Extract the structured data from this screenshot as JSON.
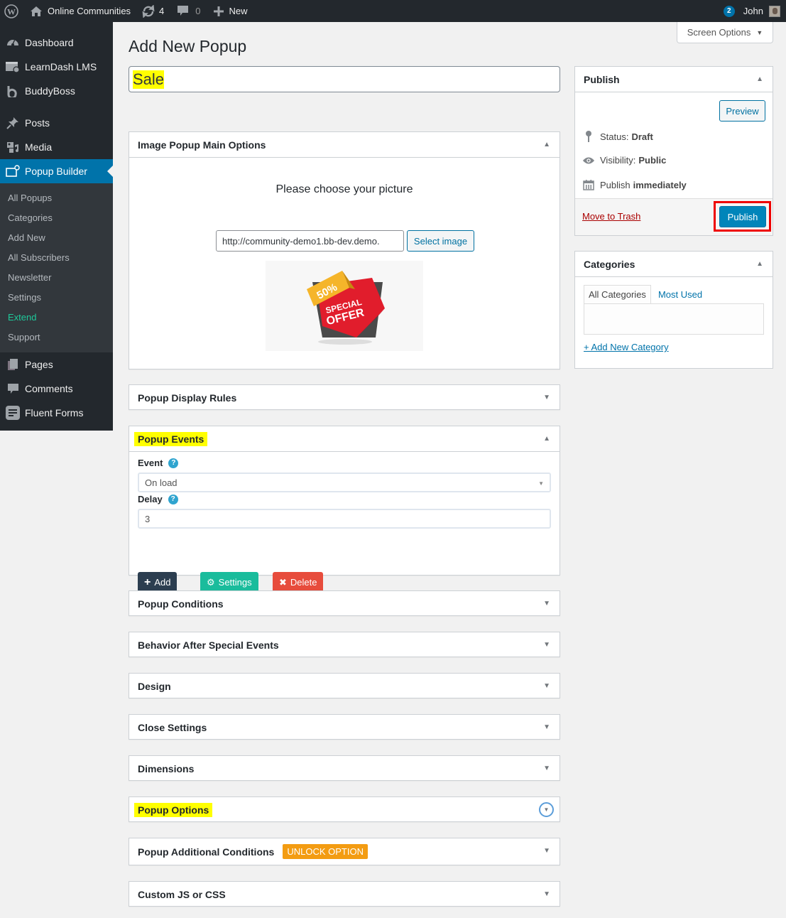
{
  "adminbar": {
    "site_name": "Online Communities",
    "updates_count": "4",
    "comments_count": "0",
    "new_label": "New",
    "notifications_count": "2",
    "user_name": "John"
  },
  "sidebar": {
    "top_items": [
      {
        "label": "Dashboard",
        "icon": "dashboard-icon"
      },
      {
        "label": "LearnDash LMS",
        "icon": "learndash-icon"
      },
      {
        "label": "BuddyBoss",
        "icon": "buddyboss-icon"
      }
    ],
    "mid_items": [
      {
        "label": "Posts",
        "icon": "pin-icon"
      },
      {
        "label": "Media",
        "icon": "media-icon"
      },
      {
        "label": "Popup Builder",
        "icon": "popup-builder-icon"
      }
    ],
    "submenu": [
      {
        "label": "All Popups"
      },
      {
        "label": "Categories"
      },
      {
        "label": "Add New"
      },
      {
        "label": "All Subscribers"
      },
      {
        "label": "Newsletter"
      },
      {
        "label": "Settings"
      },
      {
        "label": "Extend"
      },
      {
        "label": "Support"
      }
    ],
    "bottom_items": [
      {
        "label": "Pages",
        "icon": "pages-icon"
      },
      {
        "label": "Comments",
        "icon": "comments-icon"
      },
      {
        "label": "Fluent Forms",
        "icon": "fluent-forms-icon"
      }
    ],
    "accent_color": "#0073aa",
    "extend_color": "#1ec99a"
  },
  "screen_options_label": "Screen Options",
  "page_title": "Add New Popup",
  "title_value": "Sale",
  "image_options": {
    "title": "Image Popup Main Options",
    "prompt": "Please choose your picture",
    "url_value": "http://community-demo1.bb-dev.demo.",
    "select_label": "Select image",
    "image_text_top": "50%",
    "image_text_line1": "SPECIAL",
    "image_text_line2": "OFFER"
  },
  "display_rules_title": "Popup Display Rules",
  "events": {
    "title": "Popup Events",
    "event_label": "Event",
    "event_value": "On load",
    "delay_label": "Delay",
    "delay_value": "3",
    "add_label": "Add",
    "settings_label": "Settings",
    "delete_label": "Delete",
    "add_color": "#2c3e50",
    "settings_color": "#1abc9c",
    "delete_color": "#e74c3c"
  },
  "collapsed_boxes": [
    {
      "title": "Popup Conditions"
    },
    {
      "title": "Behavior After Special Events"
    },
    {
      "title": "Design"
    },
    {
      "title": "Close Settings"
    },
    {
      "title": "Dimensions"
    },
    {
      "title": "Popup Options"
    },
    {
      "title": "Popup Additional Conditions",
      "badge": "UNLOCK OPTION"
    },
    {
      "title": "Custom JS or CSS"
    }
  ],
  "publish": {
    "title": "Publish",
    "preview_label": "Preview",
    "status_label": "Status:",
    "status_value": "Draft",
    "visibility_label": "Visibility:",
    "visibility_value": "Public",
    "schedule_label": "Publish",
    "schedule_value": "immediately",
    "trash_label": "Move to Trash",
    "publish_label": "Publish"
  },
  "categories": {
    "title": "Categories",
    "tab_all": "All Categories",
    "tab_most_used": "Most Used",
    "add_new_label": "+ Add New Category"
  }
}
